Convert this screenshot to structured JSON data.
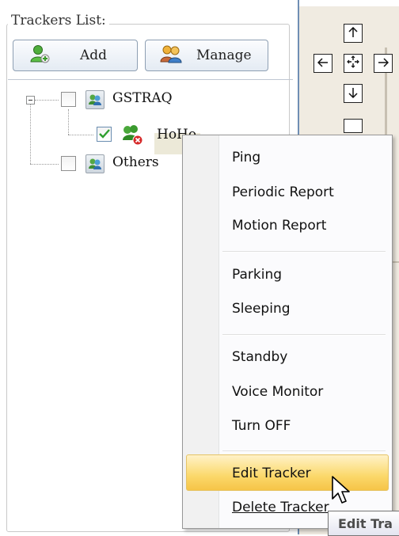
{
  "trackers_panel": {
    "title": "Trackers List:",
    "add_label": "Add",
    "manage_label": "Manage"
  },
  "tree": {
    "group1": {
      "label": "GSTRAQ",
      "checked": false,
      "expanded": true
    },
    "tracker1": {
      "label": "HoHo",
      "checked": true
    },
    "group2": {
      "label": "Others",
      "checked": false
    }
  },
  "context_menu": {
    "items": [
      "Ping",
      "Periodic Report",
      "Motion Report",
      "Parking",
      "Sleeping",
      "Standby",
      "Voice Monitor",
      "Turn OFF",
      "Edit Tracker",
      "Delete Tracker"
    ],
    "highlighted": "Edit Tracker"
  },
  "tooltip": {
    "text": "Edit Tra"
  },
  "colors": {
    "highlight": "#fbd86a",
    "panel_border": "#6f8eb4",
    "map_bg": "#f0ebe1"
  },
  "icons": {
    "add": "add-user-icon",
    "manage": "manage-users-icon",
    "group": "group-icon",
    "tracker": "tracker-offline-icon",
    "nav_up": "arrow-up-icon",
    "nav_left": "arrow-left-icon",
    "nav_center": "center-icon",
    "nav_right": "arrow-right-icon",
    "nav_down": "arrow-down-icon",
    "cursor": "mouse-cursor-icon"
  }
}
